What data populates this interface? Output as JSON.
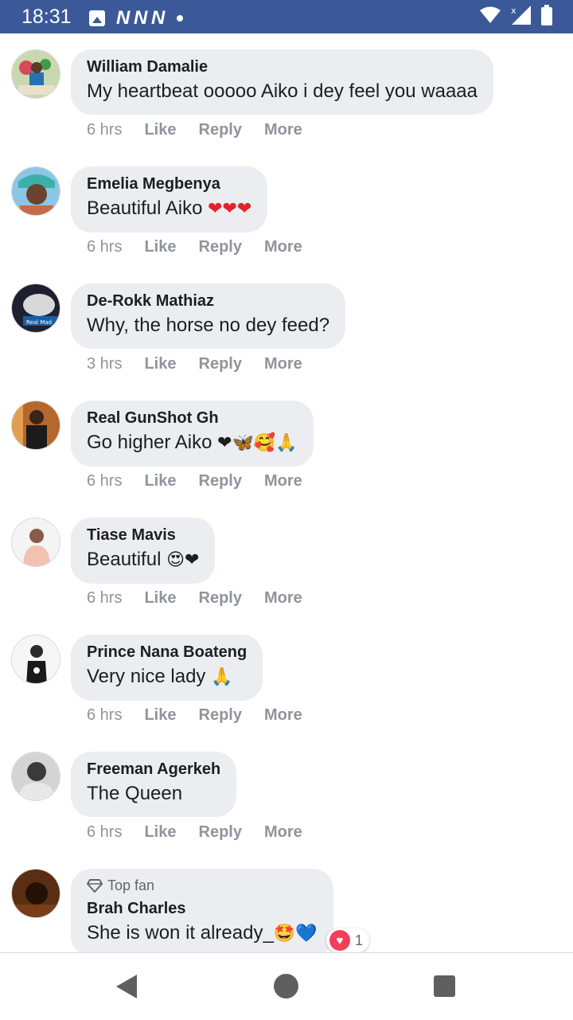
{
  "status_bar": {
    "time": "18:31",
    "brand_letters": "N N N",
    "icons": [
      "image-icon",
      "wifi-icon",
      "signal-icon",
      "battery-icon"
    ]
  },
  "actions_labels": {
    "like": "Like",
    "reply": "Reply",
    "more": "More"
  },
  "comments": [
    {
      "author": "William Damalie",
      "text": "My heartbeat ooooo Aiko i dey feel you waaaa",
      "emojis": "",
      "time": "6 hrs"
    },
    {
      "author": "Emelia Megbenya",
      "text": "Beautiful Aiko ",
      "emojis": "❤❤❤",
      "time": "6 hrs"
    },
    {
      "author": "De-Rokk Mathiaz",
      "text": "Why, the horse no dey feed?",
      "emojis": "",
      "time": "3 hrs"
    },
    {
      "author": "Real GunShot Gh",
      "text": "Go higher Aiko ",
      "emojis": "❤🦋🥰🙏",
      "time": "6 hrs"
    },
    {
      "author": "Tiase Mavis",
      "text": "Beautiful ",
      "emojis": "😍❤",
      "time": "6 hrs"
    },
    {
      "author": "Prince Nana Boateng",
      "text": "Very nice lady ",
      "emojis": "🙏",
      "time": "6 hrs"
    },
    {
      "author": "Freeman Agerkeh",
      "text": "The Queen",
      "emojis": "",
      "time": "6 hrs"
    },
    {
      "author": "Brah Charles",
      "badge": "Top fan",
      "text": "She is won it already_",
      "emojis": "🤩💙",
      "reaction_count": "1"
    }
  ],
  "colors": {
    "status_bar": "#3b5998",
    "bubble": "#ebedf0",
    "meta": "#90949c",
    "love": "#f33e58"
  }
}
